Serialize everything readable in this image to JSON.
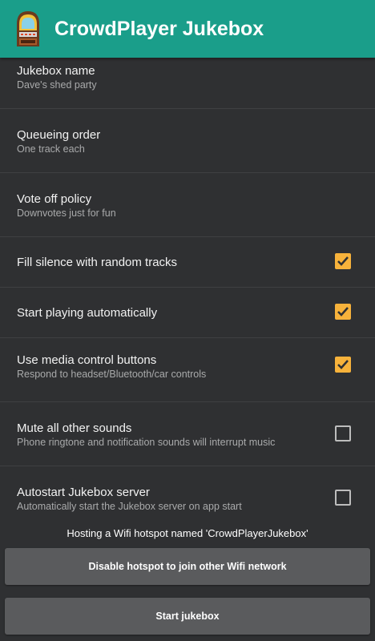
{
  "app": {
    "title": "CrowdPlayer Jukebox",
    "accent": "#1a9e8a",
    "checkbox_color": "#f7b23b"
  },
  "settings": [
    {
      "title": "Jukebox name",
      "summary": "Dave's shed party"
    },
    {
      "title": "Queueing order",
      "summary": "One track each"
    },
    {
      "title": "Vote off policy",
      "summary": "Downvotes just for fun"
    },
    {
      "title": "Fill silence with random tracks",
      "checked": true
    },
    {
      "title": "Start playing automatically",
      "checked": true
    },
    {
      "title": "Use media control buttons",
      "summary": "Respond to headset/Bluetooth/car controls",
      "checked": true
    },
    {
      "title": "Mute all other sounds",
      "summary": "Phone ringtone and notification sounds will interrupt music",
      "checked": false
    },
    {
      "title": "Autostart Jukebox server",
      "summary": "Automatically start the Jukebox server on app start",
      "checked": false
    }
  ],
  "hotspot_text": "Hosting a Wifi hotspot named 'CrowdPlayerJukebox'",
  "buttons": {
    "disable_hotspot": "Disable hotspot to join other Wifi network",
    "start": "Start jukebox"
  }
}
